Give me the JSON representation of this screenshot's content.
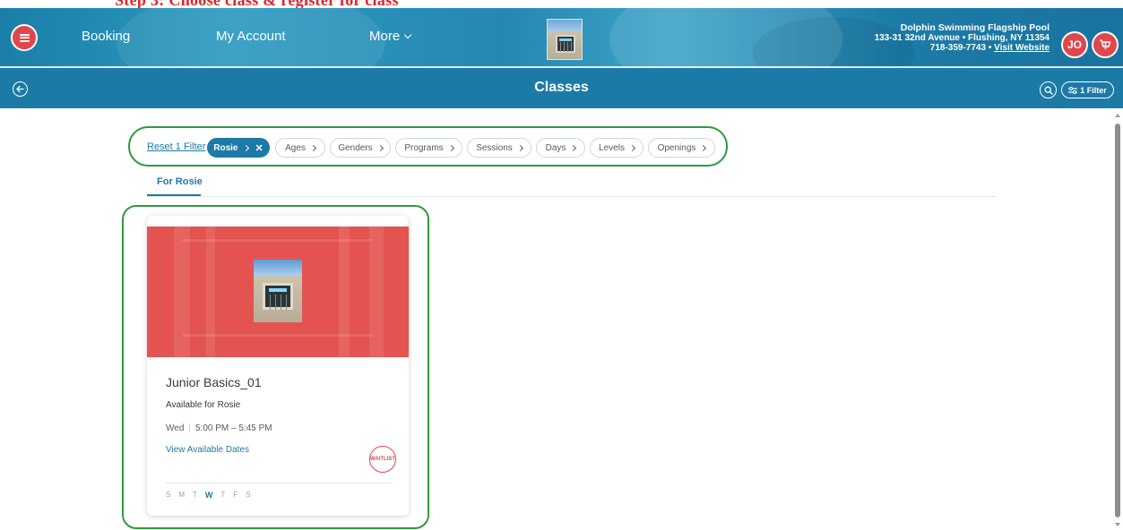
{
  "header": {
    "banner_text": "Step 3: Choose class & register for class",
    "nav": {
      "booking": "Booking",
      "my_account": "My Account",
      "more": "More"
    },
    "venue": {
      "name": "Dolphin Swimming Flagship Pool",
      "address": "133-31 32nd Avenue • Flushing, NY 11354",
      "phone": "718-359-7743",
      "separator": " • ",
      "visit": "Visit Website"
    },
    "user_initials": "JO"
  },
  "subheader": {
    "title": "Classes",
    "filter_label": "1 Filter"
  },
  "filters": {
    "reset": "Reset 1 Filter",
    "active_chip": "Rosie",
    "chips": [
      "Ages",
      "Genders",
      "Programs",
      "Sessions",
      "Days",
      "Levels",
      "Openings"
    ]
  },
  "tabs": [
    {
      "label": "For Rosie",
      "active": true
    }
  ],
  "card": {
    "title": "Junior Basics_01",
    "availability": "Available for Rosie",
    "day": "Wed",
    "time": "5:00 PM – 5:45 PM",
    "link": "View Available Dates",
    "badge": "WAITLIST",
    "days": [
      "S",
      "M",
      "T",
      "W",
      "T",
      "F",
      "S"
    ],
    "active_day_index": 3
  },
  "colors": {
    "brand_blue": "#1c7aa7",
    "accent_red": "#e0474c",
    "highlight_green": "#2e9a3e",
    "card_image_red": "#e3534f"
  },
  "icons": {
    "menu": "hamburger-menu-icon",
    "cart": "shopping-cart-icon",
    "back": "back-arrow-icon",
    "search": "search-icon",
    "filter": "sliders-icon"
  }
}
